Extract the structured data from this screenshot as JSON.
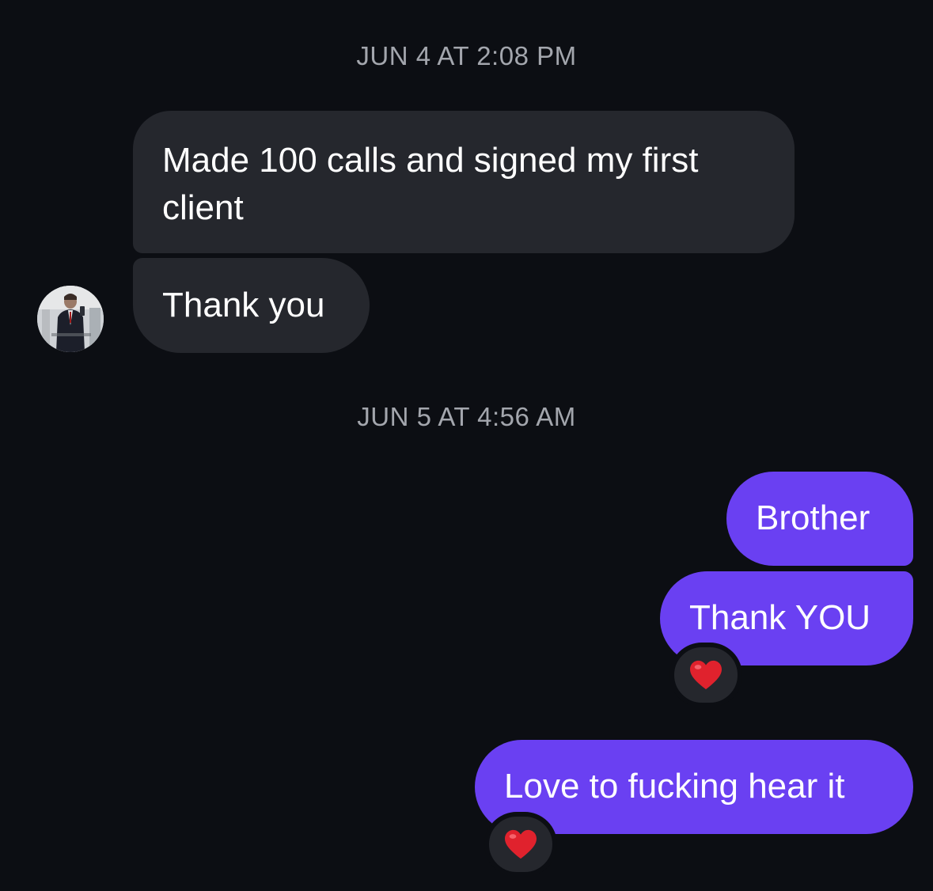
{
  "thread": {
    "timestamps": [
      "JUN 4 AT 2:08 PM",
      "JUN 5 AT 4:56 AM"
    ],
    "incoming": [
      {
        "text": "Made 100 calls and signed my first client"
      },
      {
        "text": "Thank you"
      }
    ],
    "outgoing": [
      {
        "text": "Brother"
      },
      {
        "text": "Thank YOU",
        "reaction": "heart-icon"
      },
      {
        "text": "Love to fucking hear it",
        "reaction": "heart-icon"
      }
    ]
  },
  "colors": {
    "background": "#0c0e13",
    "incoming_bubble": "#25272d",
    "outgoing_bubble": "#6a40f2",
    "timestamp_text": "#a3a6ad",
    "heart": "#e0222d"
  }
}
